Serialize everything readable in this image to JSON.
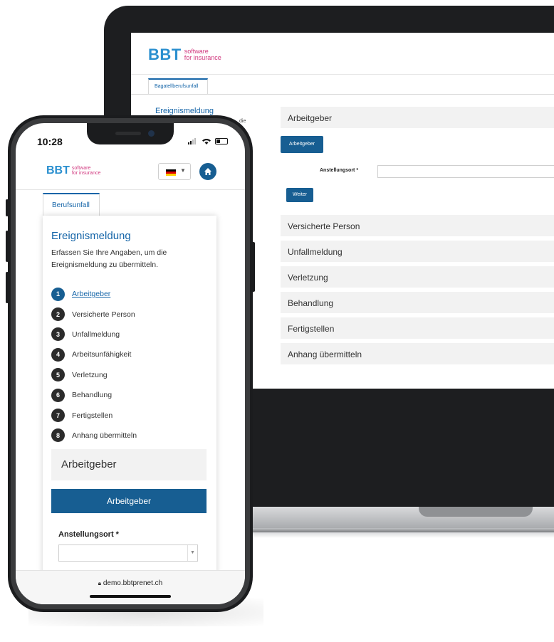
{
  "laptop": {
    "logo": {
      "brand": "BBT",
      "tagline_1": "software",
      "tagline_2": "for insurance"
    },
    "tab_label": "Bagatellberufsunfall",
    "left_title": "Ereignismeldung",
    "left_fragment": "die",
    "first_section": "Arbeitgeber",
    "section_button": "Arbeitgeber",
    "field_label": "Anstellungsort *",
    "next_button": "Weiter",
    "sections": [
      "Versicherte Person",
      "Unfallmeldung",
      "Verletzung",
      "Behandlung",
      "Fertigstellen",
      "Anhang übermitteln"
    ]
  },
  "phone": {
    "time": "10:28",
    "logo": {
      "brand": "BBT",
      "tagline_1": "software",
      "tagline_2": "for insurance"
    },
    "tab_label": "Berufsunfall",
    "title": "Ereignismeldung",
    "description": "Erfassen Sie Ihre Angaben, um die Ereignismeldung zu übermitteln.",
    "steps": [
      {
        "num": "1",
        "label": "Arbeitgeber"
      },
      {
        "num": "2",
        "label": "Versicherte Person"
      },
      {
        "num": "3",
        "label": "Unfallmeldung"
      },
      {
        "num": "4",
        "label": "Arbeitsunfähigkeit"
      },
      {
        "num": "5",
        "label": "Verletzung"
      },
      {
        "num": "6",
        "label": "Behandlung"
      },
      {
        "num": "7",
        "label": "Fertigstellen"
      },
      {
        "num": "8",
        "label": "Anhang übermitteln"
      }
    ],
    "active_step": "1",
    "section_header": "Arbeitgeber",
    "section_button": "Arbeitgeber",
    "field_label": "Anstellungsort *",
    "url": "demo.bbtprenet.ch"
  },
  "colors": {
    "accent": "#175e92",
    "link": "#1565a8",
    "logo_blue": "#2a8fcf",
    "logo_pink": "#d0367d"
  }
}
